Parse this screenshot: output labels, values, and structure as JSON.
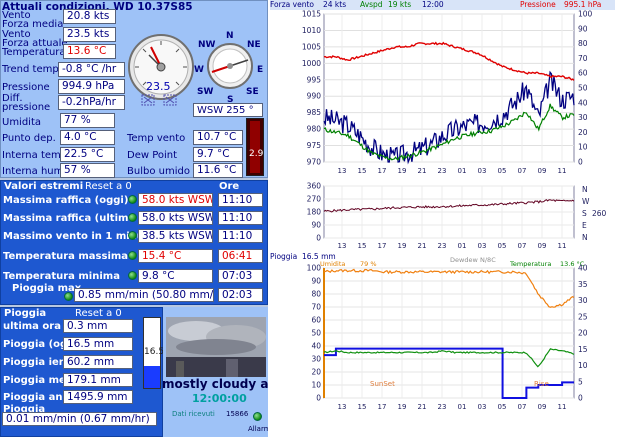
{
  "header": {
    "title": "Attuali condizioni, WD 10.37S85"
  },
  "current": {
    "vento_label": "Vento",
    "vento_value": "20.8 kts",
    "forza_media_label": "Forza media",
    "vento2_label": "Vento",
    "vento2_value": "23.5 kts",
    "forza_attuale_label": "Forza attuale",
    "temperatura_label": "Temperatura",
    "temperatura_value": "13.6 °C",
    "trend_label": "Trend temp",
    "trend_value": "-0.8 °C /hr",
    "pressione_label": "Pressione",
    "pressione_value": "994.9 hPa",
    "diff_label": "Diff.",
    "diff_label2": "pressione",
    "diff_value": "-0.2hPa/hr",
    "umidita_label": "Umidita",
    "umidita_value": "77 %",
    "punto_label": "Punto dep.",
    "punto_value": "4.0 °C",
    "int_temp_label": "Interna temp.",
    "int_temp_value": "22.5 °C",
    "int_hum_label": "Interna hum",
    "int_hum_value": "57 %",
    "temp_vento_label": "Temp vento",
    "temp_vento_value": "10.7 °C",
    "dew_label": "Dew Point",
    "dew_value": "9.7 °C",
    "bulbo_label": "Bulbo umido",
    "bulbo_value": "11.6 °C",
    "gauge_value": "23.5",
    "wind_dir_value": "WSW 255 °",
    "thermo_value": "2.9"
  },
  "compass": {
    "n": "N",
    "ne": "NE",
    "e": "E",
    "se": "SE",
    "s": "S",
    "sw": "SW",
    "w": "W",
    "nw": "NW"
  },
  "extremes": {
    "title": "Valori estremi",
    "reset": "Reset a 0",
    "ore": "Ore",
    "rows": [
      {
        "label": "Massima raffica (oggi)",
        "value": "58.0 kts WSW",
        "time": "11:10",
        "value_red": true,
        "time_red": false
      },
      {
        "label": "Massima raffica (ultima ora)",
        "value": "58.0 kts WSW",
        "time": "11:10",
        "value_red": false,
        "time_red": false
      },
      {
        "label": "Massimo vento in 1 minuto",
        "value": "38.5 kts WSW",
        "time": "11:10",
        "value_red": false,
        "time_red": false
      },
      {
        "label": "Temperatura massima",
        "value": "15.4 °C",
        "time": "06:41",
        "value_red": true,
        "time_red": true
      },
      {
        "label": "Temperatura minima",
        "value": "9.8 °C",
        "time": "07:03",
        "value_red": false,
        "time_red": false
      }
    ],
    "pioggia_max_label": "Pioggia max",
    "pioggia_max_value": "0.85 mm/min (50.80 mm/hr)",
    "pioggia_max_time": "02:03"
  },
  "rain": {
    "title": "Pioggia",
    "reset": "Reset a 0",
    "rows": [
      {
        "label": "ultima ora",
        "value": "0.3 mm"
      },
      {
        "label": "Pioggia (oggi)",
        "value": "16.5 mm"
      },
      {
        "label": "Pioggia ieri",
        "value": "60.2 mm"
      },
      {
        "label": "Pioggia mese",
        "value": "179.1 mm"
      },
      {
        "label": "Pioggia anno",
        "value": "1495.9 mm"
      }
    ],
    "rate_label": "Pioggia",
    "rate_value": "0.01 mm/min (0.67 mm/hr)",
    "bar_value": "16.5",
    "bar_fill": 0.32
  },
  "webcam": {
    "description": "mostly cloudy an",
    "time": "12:00:00",
    "received_label": "Dati ricevuti",
    "received_value": "15866",
    "allarm_label": "Allarm"
  },
  "chart_top": {
    "header": {
      "forza_vento": "Forza vento",
      "kts": "24 kts",
      "avspd": "Avspd",
      "avspd_val": "19 kts",
      "time": "12:00",
      "pressione": "Pressione",
      "press_val": "995.1 hPa"
    },
    "colors": {
      "pressure": "#e00000",
      "gust": "#000080",
      "avg": "#008000"
    }
  },
  "chart_dir": {
    "labels": {
      "n": "N",
      "w": "W",
      "s": "S",
      "e": "E",
      "n2": "N"
    },
    "value": "260"
  },
  "chart_bottom": {
    "header": {
      "pioggia": "Pioggia",
      "pioggia_val": "16.5 mm",
      "umidita": "Umidita",
      "umidita_val": "79 %",
      "dew": "Dewdew",
      "dew_val": "N/8C",
      "temperatura": "Temperatura",
      "temp_val": "13.6 °C"
    },
    "sunset": "SunSet",
    "sunrise": "Rise"
  },
  "chart_data": [
    {
      "type": "line",
      "title": "",
      "x_ticks": [
        "13",
        "15",
        "17",
        "19",
        "21",
        "23",
        "01",
        "03",
        "05",
        "07",
        "09",
        "11"
      ],
      "ylim_left": [
        970,
        1015
      ],
      "ylim_right": [
        0,
        100
      ],
      "series": [
        {
          "name": "Pressione",
          "axis": "left",
          "values": [
            1002,
            1002,
            1001,
            1002,
            1003,
            1004,
            1005,
            1005,
            1006,
            1006,
            1006,
            1005,
            1004,
            1003,
            1001,
            999,
            998,
            997,
            997,
            996,
            996,
            995
          ]
        },
        {
          "name": "Forza vento",
          "axis": "right",
          "values": [
            30,
            28,
            25,
            18,
            10,
            5,
            3,
            6,
            8,
            12,
            18,
            22,
            25,
            26,
            28,
            32,
            40,
            50,
            30,
            55,
            42,
            45
          ]
        },
        {
          "name": "Avspd",
          "axis": "right",
          "values": [
            22,
            20,
            18,
            12,
            6,
            3,
            2,
            4,
            6,
            9,
            12,
            16,
            18,
            20,
            21,
            24,
            28,
            34,
            22,
            38,
            30,
            32
          ]
        }
      ]
    },
    {
      "type": "line",
      "x_ticks": [
        "13",
        "15",
        "17",
        "19",
        "21",
        "23",
        "01",
        "03",
        "05",
        "07",
        "09",
        "11"
      ],
      "ylim": [
        0,
        360
      ],
      "series": [
        {
          "name": "Direzione",
          "values": [
            185,
            190,
            195,
            198,
            200,
            205,
            210,
            212,
            215,
            215,
            218,
            220,
            225,
            228,
            230,
            235,
            240,
            245,
            250,
            262,
            255,
            260
          ]
        }
      ]
    },
    {
      "type": "line",
      "x_ticks": [
        "13",
        "15",
        "17",
        "19",
        "21",
        "23",
        "01",
        "03",
        "05",
        "07",
        "09",
        "11"
      ],
      "ylim_left": [
        0,
        100
      ],
      "ylim_right": [
        0,
        40
      ],
      "series": [
        {
          "name": "Pioggia",
          "axis": "left",
          "values": [
            33,
            38,
            38,
            38,
            38,
            38,
            38,
            38,
            38,
            38,
            38,
            38,
            38,
            38,
            38,
            0,
            0,
            8,
            10,
            10,
            12,
            12
          ]
        },
        {
          "name": "Umidita",
          "axis": "left",
          "values": [
            97,
            98,
            98,
            98,
            98,
            97,
            97,
            97,
            97,
            97,
            97,
            97,
            97,
            97,
            97,
            97,
            97,
            96,
            80,
            70,
            72,
            78
          ]
        },
        {
          "name": "Temperatura",
          "axis": "right",
          "values": [
            14,
            14.5,
            14,
            14,
            14,
            14,
            14,
            14,
            14,
            14,
            14.5,
            14,
            14,
            14,
            14,
            14,
            14,
            14,
            9.5,
            15,
            14.5,
            13.6
          ]
        }
      ]
    }
  ]
}
